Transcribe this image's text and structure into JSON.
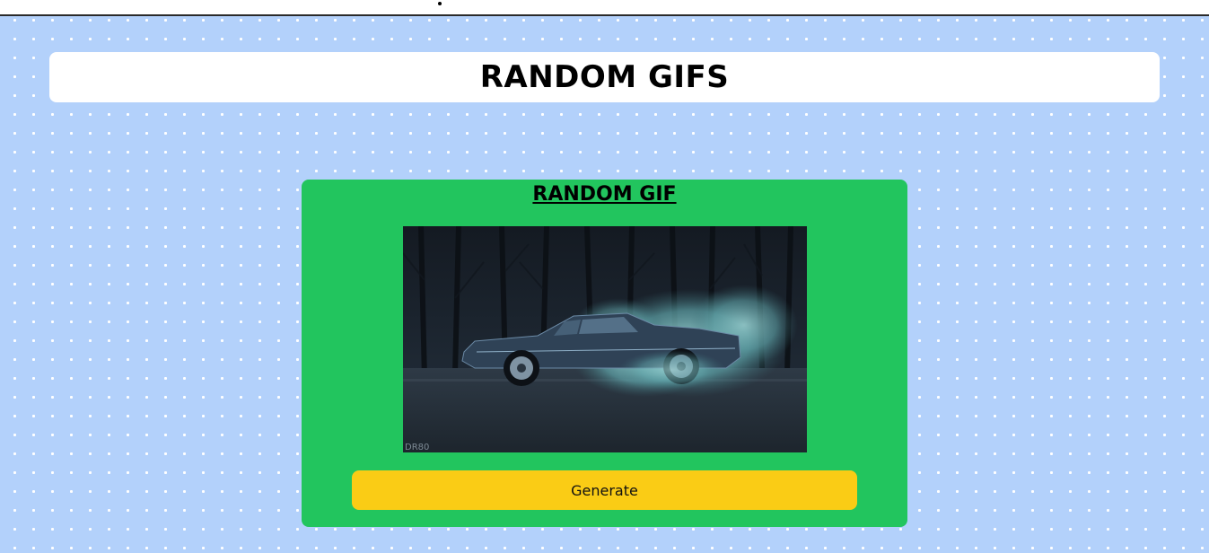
{
  "header": {
    "title": "RANDOM GIFS"
  },
  "card": {
    "title": "RANDOM GIF",
    "image_watermark": "DR80",
    "button_label": "Generate"
  },
  "colors": {
    "background": "#b3d1fb",
    "card": "#22c55e",
    "button": "#facc15",
    "header_bar": "#ffffff"
  },
  "icons": {
    "image": "car-burnout-gif"
  }
}
